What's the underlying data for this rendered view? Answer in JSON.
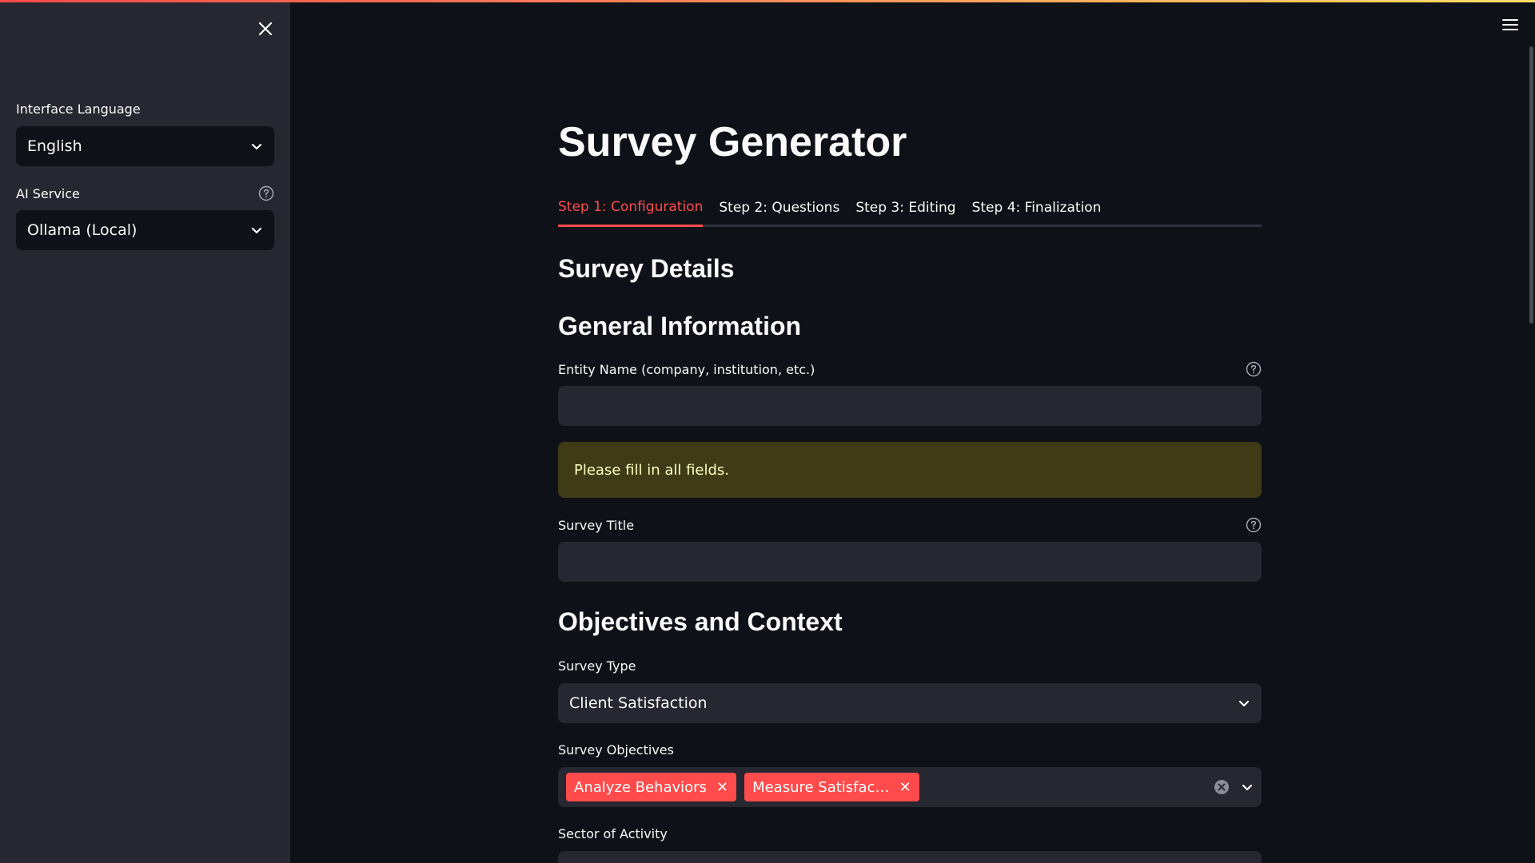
{
  "sidebar": {
    "language_label": "Interface Language",
    "language_value": "English",
    "ai_label": "AI Service",
    "ai_value": "Ollama (Local)"
  },
  "main": {
    "title": "Survey Generator",
    "tabs": [
      {
        "label": "Step 1: Configuration",
        "active": true
      },
      {
        "label": "Step 2: Questions",
        "active": false
      },
      {
        "label": "Step 3: Editing",
        "active": false
      },
      {
        "label": "Step 4: Finalization",
        "active": false
      }
    ],
    "section_title": "Survey Details",
    "general_title": "General Information",
    "entity_label": "Entity Name (company, institution, etc.)",
    "entity_value": "",
    "warning_text": "Please fill in all fields.",
    "survey_title_label": "Survey Title",
    "survey_title_value": "",
    "objectives_title": "Objectives and Context",
    "survey_type_label": "Survey Type",
    "survey_type_value": "Client Satisfaction",
    "objectives_label": "Survey Objectives",
    "objectives_tags": [
      "Analyze Behaviors",
      "Measure Satisfac…"
    ],
    "sector_label": "Sector of Activity"
  },
  "colors": {
    "accent": "#ff4b4b",
    "background": "#0e1117",
    "sidebar": "#262730",
    "warning_bg": "#3e3b16",
    "warning_text": "#ffffc2"
  }
}
